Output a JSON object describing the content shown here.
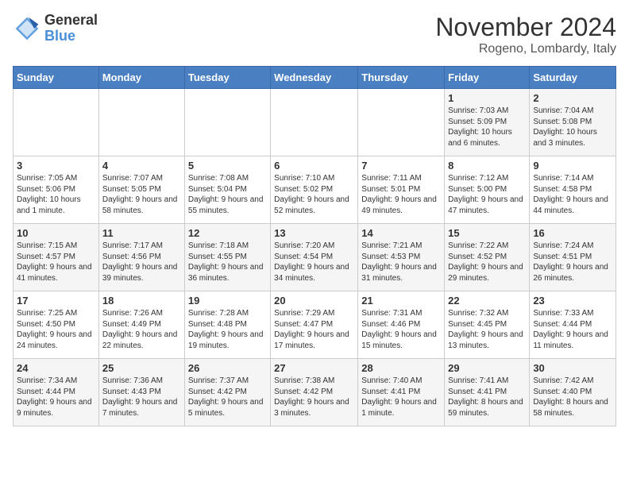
{
  "header": {
    "logo_general": "General",
    "logo_blue": "Blue",
    "month_title": "November 2024",
    "location": "Rogeno, Lombardy, Italy"
  },
  "weekdays": [
    "Sunday",
    "Monday",
    "Tuesday",
    "Wednesday",
    "Thursday",
    "Friday",
    "Saturday"
  ],
  "weeks": [
    [
      {
        "day": "",
        "info": ""
      },
      {
        "day": "",
        "info": ""
      },
      {
        "day": "",
        "info": ""
      },
      {
        "day": "",
        "info": ""
      },
      {
        "day": "",
        "info": ""
      },
      {
        "day": "1",
        "info": "Sunrise: 7:03 AM\nSunset: 5:09 PM\nDaylight: 10 hours\nand 6 minutes."
      },
      {
        "day": "2",
        "info": "Sunrise: 7:04 AM\nSunset: 5:08 PM\nDaylight: 10 hours\nand 3 minutes."
      }
    ],
    [
      {
        "day": "3",
        "info": "Sunrise: 7:05 AM\nSunset: 5:06 PM\nDaylight: 10 hours\nand 1 minute."
      },
      {
        "day": "4",
        "info": "Sunrise: 7:07 AM\nSunset: 5:05 PM\nDaylight: 9 hours\nand 58 minutes."
      },
      {
        "day": "5",
        "info": "Sunrise: 7:08 AM\nSunset: 5:04 PM\nDaylight: 9 hours\nand 55 minutes."
      },
      {
        "day": "6",
        "info": "Sunrise: 7:10 AM\nSunset: 5:02 PM\nDaylight: 9 hours\nand 52 minutes."
      },
      {
        "day": "7",
        "info": "Sunrise: 7:11 AM\nSunset: 5:01 PM\nDaylight: 9 hours\nand 49 minutes."
      },
      {
        "day": "8",
        "info": "Sunrise: 7:12 AM\nSunset: 5:00 PM\nDaylight: 9 hours\nand 47 minutes."
      },
      {
        "day": "9",
        "info": "Sunrise: 7:14 AM\nSunset: 4:58 PM\nDaylight: 9 hours\nand 44 minutes."
      }
    ],
    [
      {
        "day": "10",
        "info": "Sunrise: 7:15 AM\nSunset: 4:57 PM\nDaylight: 9 hours\nand 41 minutes."
      },
      {
        "day": "11",
        "info": "Sunrise: 7:17 AM\nSunset: 4:56 PM\nDaylight: 9 hours\nand 39 minutes."
      },
      {
        "day": "12",
        "info": "Sunrise: 7:18 AM\nSunset: 4:55 PM\nDaylight: 9 hours\nand 36 minutes."
      },
      {
        "day": "13",
        "info": "Sunrise: 7:20 AM\nSunset: 4:54 PM\nDaylight: 9 hours\nand 34 minutes."
      },
      {
        "day": "14",
        "info": "Sunrise: 7:21 AM\nSunset: 4:53 PM\nDaylight: 9 hours\nand 31 minutes."
      },
      {
        "day": "15",
        "info": "Sunrise: 7:22 AM\nSunset: 4:52 PM\nDaylight: 9 hours\nand 29 minutes."
      },
      {
        "day": "16",
        "info": "Sunrise: 7:24 AM\nSunset: 4:51 PM\nDaylight: 9 hours\nand 26 minutes."
      }
    ],
    [
      {
        "day": "17",
        "info": "Sunrise: 7:25 AM\nSunset: 4:50 PM\nDaylight: 9 hours\nand 24 minutes."
      },
      {
        "day": "18",
        "info": "Sunrise: 7:26 AM\nSunset: 4:49 PM\nDaylight: 9 hours\nand 22 minutes."
      },
      {
        "day": "19",
        "info": "Sunrise: 7:28 AM\nSunset: 4:48 PM\nDaylight: 9 hours\nand 19 minutes."
      },
      {
        "day": "20",
        "info": "Sunrise: 7:29 AM\nSunset: 4:47 PM\nDaylight: 9 hours\nand 17 minutes."
      },
      {
        "day": "21",
        "info": "Sunrise: 7:31 AM\nSunset: 4:46 PM\nDaylight: 9 hours\nand 15 minutes."
      },
      {
        "day": "22",
        "info": "Sunrise: 7:32 AM\nSunset: 4:45 PM\nDaylight: 9 hours\nand 13 minutes."
      },
      {
        "day": "23",
        "info": "Sunrise: 7:33 AM\nSunset: 4:44 PM\nDaylight: 9 hours\nand 11 minutes."
      }
    ],
    [
      {
        "day": "24",
        "info": "Sunrise: 7:34 AM\nSunset: 4:44 PM\nDaylight: 9 hours\nand 9 minutes."
      },
      {
        "day": "25",
        "info": "Sunrise: 7:36 AM\nSunset: 4:43 PM\nDaylight: 9 hours\nand 7 minutes."
      },
      {
        "day": "26",
        "info": "Sunrise: 7:37 AM\nSunset: 4:42 PM\nDaylight: 9 hours\nand 5 minutes."
      },
      {
        "day": "27",
        "info": "Sunrise: 7:38 AM\nSunset: 4:42 PM\nDaylight: 9 hours\nand 3 minutes."
      },
      {
        "day": "28",
        "info": "Sunrise: 7:40 AM\nSunset: 4:41 PM\nDaylight: 9 hours\nand 1 minute."
      },
      {
        "day": "29",
        "info": "Sunrise: 7:41 AM\nSunset: 4:41 PM\nDaylight: 8 hours\nand 59 minutes."
      },
      {
        "day": "30",
        "info": "Sunrise: 7:42 AM\nSunset: 4:40 PM\nDaylight: 8 hours\nand 58 minutes."
      }
    ]
  ]
}
